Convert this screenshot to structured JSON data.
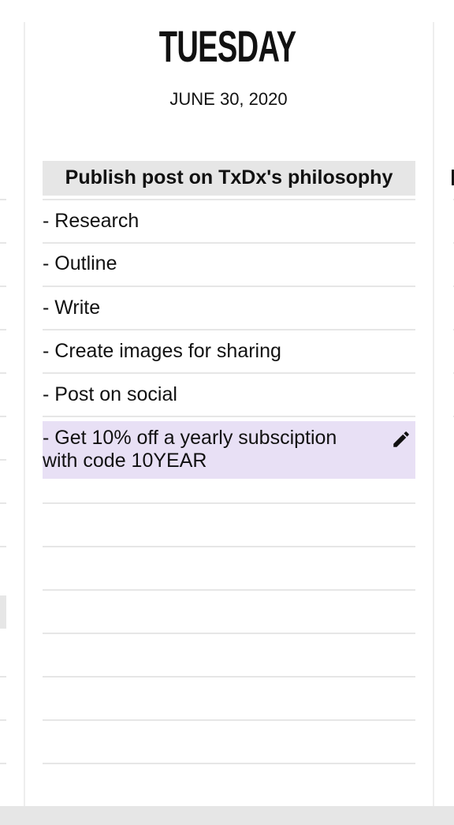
{
  "day": {
    "name": "TUESDAY",
    "date": "JUNE 30, 2020",
    "task_header": "Publish post on TxDx's philosophy",
    "items": [
      "- Research",
      "- Outline",
      "- Write",
      "- Create images for sharing",
      "- Post on social"
    ],
    "highlighted_item": "- Get 10% off a yearly subsciption with code 10YEAR",
    "highlight_color": "#e8e0f5",
    "edit_icon": "pencil-icon"
  }
}
